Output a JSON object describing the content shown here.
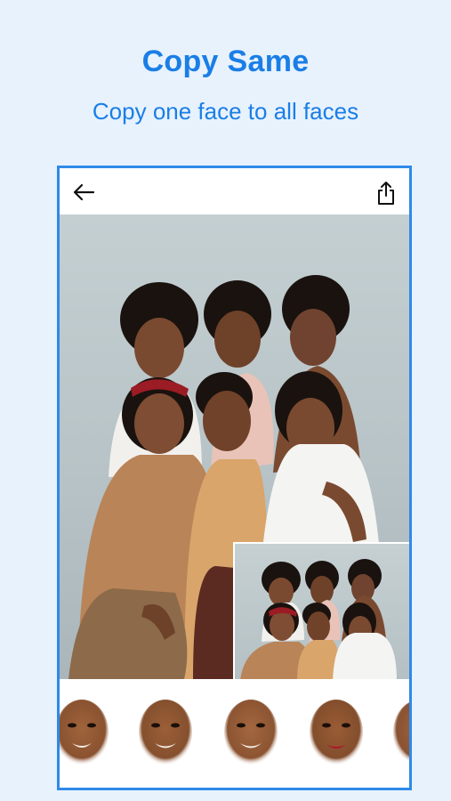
{
  "header": {
    "title": "Copy Same",
    "subtitle": "Copy one face to all faces"
  },
  "toolbar": {
    "back_icon": "arrow-left-icon",
    "share_icon": "share-icon"
  },
  "photo": {
    "description_role": "main-group-photo",
    "inset_role": "original-photo-preview"
  },
  "face_strip": {
    "items": [
      {
        "id": "face-1"
      },
      {
        "id": "face-2"
      },
      {
        "id": "face-3"
      },
      {
        "id": "face-4"
      },
      {
        "id": "face-5"
      }
    ]
  },
  "colors": {
    "accent": "#1a7ee6",
    "background": "#e8f2fd",
    "frame": "#2f8ae8"
  }
}
